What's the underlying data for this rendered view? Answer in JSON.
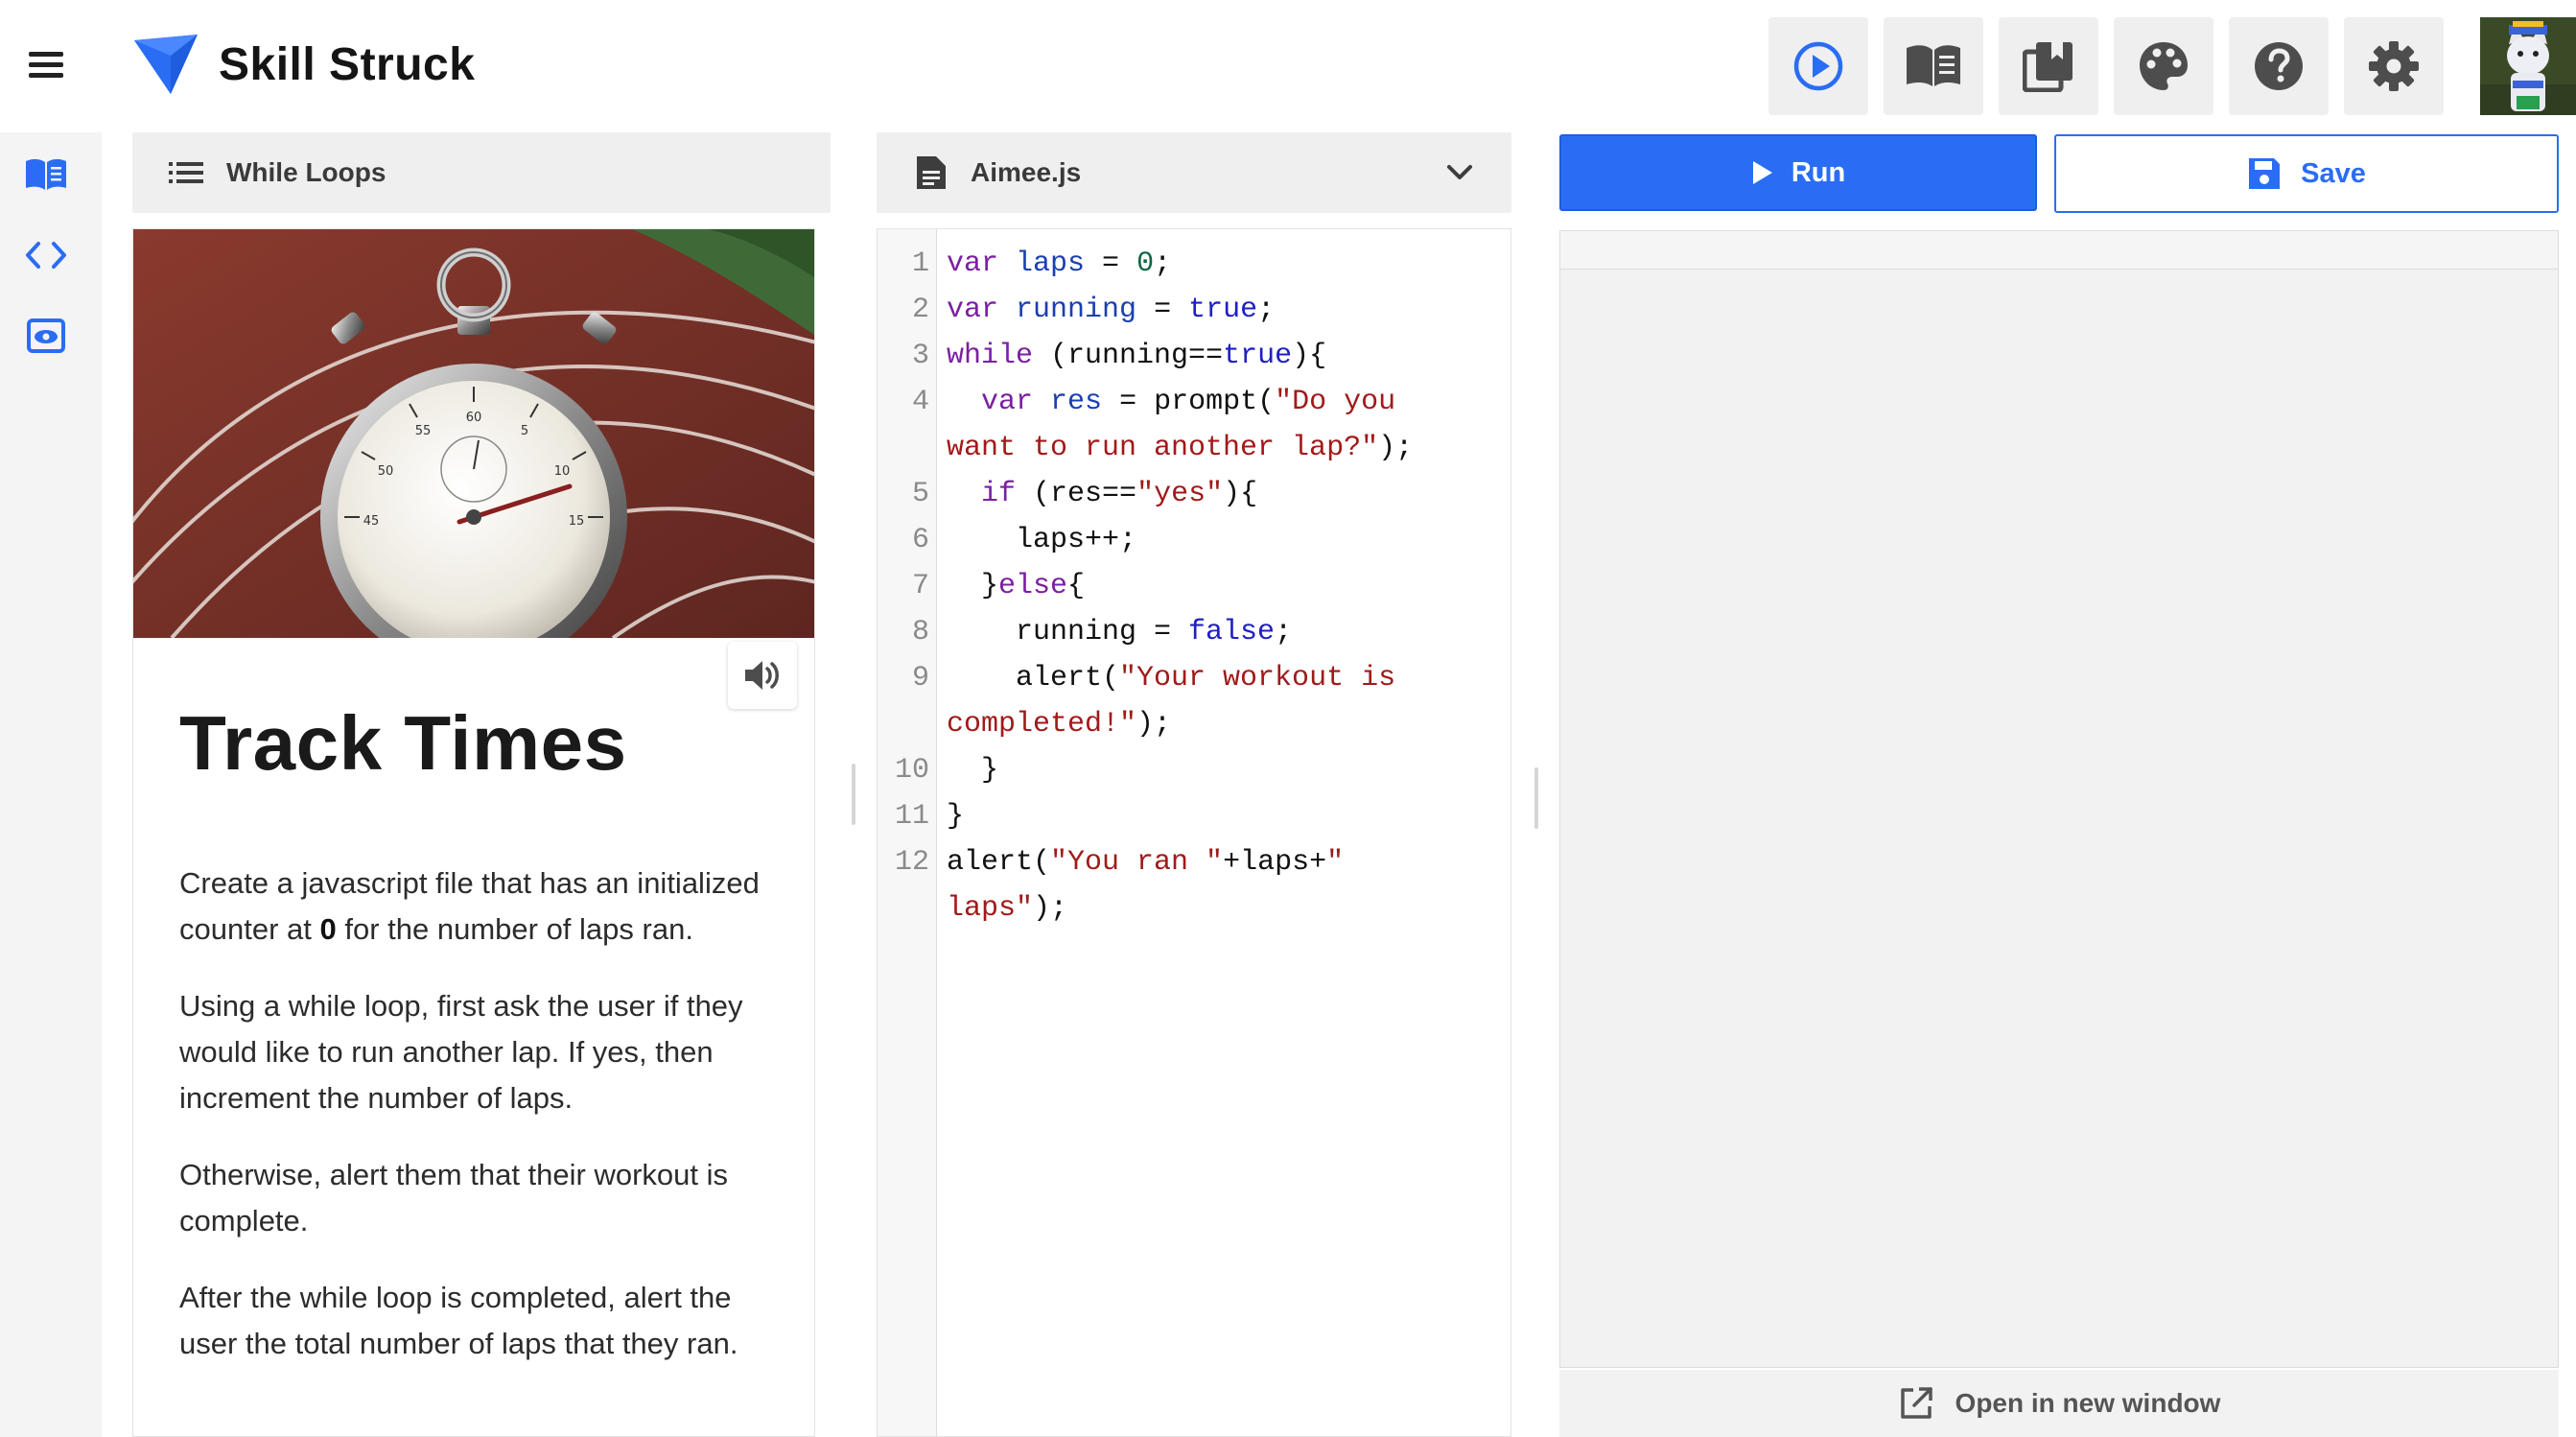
{
  "app": {
    "name": "Skill Struck",
    "colors": {
      "accent": "#2a6df4",
      "brand_logo": "#1f5ddf"
    }
  },
  "topbar": {
    "menu_icon": "hamburger-menu-icon",
    "tools": [
      {
        "name": "run-preview-button",
        "icon": "play-circle-icon"
      },
      {
        "name": "lesson-book-button",
        "icon": "open-book-icon"
      },
      {
        "name": "library-button",
        "icon": "stacked-books-icon"
      },
      {
        "name": "theme-button",
        "icon": "palette-icon"
      },
      {
        "name": "help-button",
        "icon": "help-circle-icon"
      },
      {
        "name": "settings-button",
        "icon": "gear-icon"
      }
    ]
  },
  "rail": {
    "items": [
      {
        "name": "rail-lesson",
        "icon": "book-icon"
      },
      {
        "name": "rail-code",
        "icon": "code-brackets-icon"
      },
      {
        "name": "rail-preview",
        "icon": "eye-icon"
      }
    ]
  },
  "lesson": {
    "header": "While Loops",
    "title": "Track Times",
    "paragraphs": [
      {
        "before": "Create a javascript file that has an initialized counter at ",
        "bold": "0",
        "after": " for the number of laps ran."
      },
      {
        "text": "Using a while loop, first ask the user if they would like to run another lap. If yes, then increment the number of laps."
      },
      {
        "text": "Otherwise, alert them that their workout is complete."
      },
      {
        "text": "After the while loop is completed, alert the user the total number of laps that they ran."
      }
    ]
  },
  "editor": {
    "file_name": "Aimee.js",
    "lines": [
      {
        "n": "1",
        "tokens": [
          [
            "kw",
            "var"
          ],
          [
            "p",
            " "
          ],
          [
            "def",
            "laps"
          ],
          [
            "p",
            " = "
          ],
          [
            "num",
            "0"
          ],
          [
            "p",
            ";"
          ]
        ]
      },
      {
        "n": "2",
        "tokens": [
          [
            "kw",
            "var"
          ],
          [
            "p",
            " "
          ],
          [
            "def",
            "running"
          ],
          [
            "p",
            " = "
          ],
          [
            "atom",
            "true"
          ],
          [
            "p",
            ";"
          ]
        ]
      },
      {
        "n": "3",
        "tokens": [
          [
            "kw",
            "while"
          ],
          [
            "p",
            " (running=="
          ],
          [
            "atom",
            "true"
          ],
          [
            "p",
            "){"
          ]
        ]
      },
      {
        "n": "4",
        "tokens": [
          [
            "p",
            "  "
          ],
          [
            "kw",
            "var"
          ],
          [
            "p",
            " "
          ],
          [
            "def",
            "res"
          ],
          [
            "p",
            " = prompt("
          ],
          [
            "str",
            "\"Do you"
          ]
        ]
      },
      {
        "n": "",
        "tokens": [
          [
            "str",
            "want to run another lap?\""
          ],
          [
            "p",
            ");"
          ]
        ]
      },
      {
        "n": "5",
        "tokens": [
          [
            "p",
            "  "
          ],
          [
            "kw",
            "if"
          ],
          [
            "p",
            " (res=="
          ],
          [
            "str",
            "\"yes\""
          ],
          [
            "p",
            "){"
          ]
        ]
      },
      {
        "n": "6",
        "tokens": [
          [
            "p",
            "    laps++;"
          ]
        ]
      },
      {
        "n": "7",
        "tokens": [
          [
            "p",
            "  }"
          ],
          [
            "kw",
            "else"
          ],
          [
            "p",
            "{"
          ]
        ]
      },
      {
        "n": "8",
        "tokens": [
          [
            "p",
            "    running = "
          ],
          [
            "atom",
            "false"
          ],
          [
            "p",
            ";"
          ]
        ]
      },
      {
        "n": "9",
        "tokens": [
          [
            "p",
            "    alert("
          ],
          [
            "str",
            "\"Your workout is"
          ]
        ]
      },
      {
        "n": "",
        "tokens": [
          [
            "str",
            "completed!\""
          ],
          [
            "p",
            ");"
          ]
        ]
      },
      {
        "n": "10",
        "tokens": [
          [
            "p",
            "  }"
          ]
        ]
      },
      {
        "n": "11",
        "tokens": [
          [
            "p",
            "}"
          ]
        ]
      },
      {
        "n": "12",
        "tokens": [
          [
            "p",
            "alert("
          ],
          [
            "str",
            "\"You ran \""
          ],
          [
            "p",
            "+laps+"
          ],
          [
            "str",
            "\""
          ]
        ]
      },
      {
        "n": "",
        "tokens": [
          [
            "str",
            "laps\""
          ],
          [
            "p",
            ");"
          ]
        ]
      }
    ]
  },
  "output": {
    "run_label": "Run",
    "save_label": "Save",
    "open_window_label": "Open in new window"
  }
}
